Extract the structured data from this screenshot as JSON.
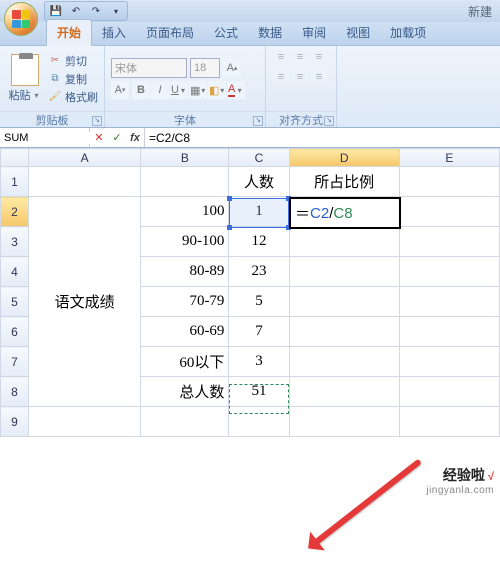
{
  "window": {
    "title_right": "新建"
  },
  "qat": {
    "items": [
      "save",
      "undo",
      "redo"
    ]
  },
  "tabs": [
    "开始",
    "插入",
    "页面布局",
    "公式",
    "数据",
    "审阅",
    "视图",
    "加载项"
  ],
  "active_tab": "开始",
  "ribbon": {
    "clipboard": {
      "paste": "粘贴",
      "cut": "剪切",
      "copy": "复制",
      "format_painter": "格式刷",
      "group_label": "剪贴板"
    },
    "font": {
      "name": "宋体",
      "size": "18",
      "group_label": "字体"
    },
    "alignment": {
      "group_label": "对齐方式"
    }
  },
  "formula_bar": {
    "name_box": "SUM",
    "formula": "=C2/C8"
  },
  "columns": [
    "A",
    "B",
    "C",
    "D",
    "E"
  ],
  "rows": [
    "1",
    "2",
    "3",
    "4",
    "5",
    "6",
    "7",
    "8",
    "9"
  ],
  "headers": {
    "c1": "人数",
    "d1": "所占比例"
  },
  "merged_a": "语文成绩",
  "table": {
    "b": [
      "100",
      "90-100",
      "80-89",
      "70-79",
      "60-69",
      "60以下",
      "总人数"
    ],
    "c": [
      "1",
      "12",
      "23",
      "5",
      "7",
      "3",
      "51"
    ]
  },
  "editing_cell": {
    "prefix": "＝",
    "ref1": "C2",
    "sep": "/",
    "ref2": "C8"
  },
  "watermark": {
    "brand": "经验啦",
    "check": "√",
    "url": "jingyanla.com"
  }
}
